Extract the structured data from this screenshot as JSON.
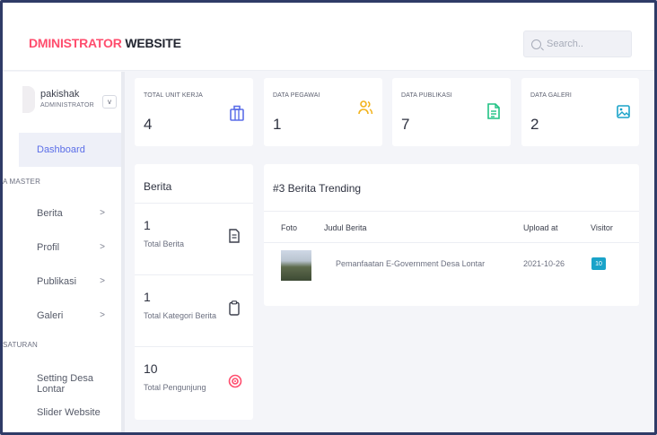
{
  "brand": {
    "accent": "DMINISTRATOR",
    "rest": " WEBSITE"
  },
  "search": {
    "placeholder": "Search.."
  },
  "profile": {
    "name": "pakishak",
    "role": "ADMINISTRATOR",
    "chevron": "v"
  },
  "sidebar": {
    "active": "Dashboard",
    "section_master": "A MASTER",
    "section_pengaturan": "SATURAN",
    "items": [
      {
        "label": "Berita",
        "chev": ">"
      },
      {
        "label": "Profil",
        "chev": ">"
      },
      {
        "label": "Publikasi",
        "chev": ">"
      },
      {
        "label": "Galeri",
        "chev": ">"
      }
    ],
    "settings": [
      {
        "label": "Setting Desa Lontar"
      },
      {
        "label": "Slider Website"
      }
    ]
  },
  "stats": [
    {
      "label": "TOTAL UNIT KERJA",
      "value": "4",
      "icon": "briefcase-icon",
      "color": "#5b6ee8"
    },
    {
      "label": "DATA PEGAWAI",
      "value": "1",
      "icon": "users-icon",
      "color": "#f2b21b"
    },
    {
      "label": "DATA PUBLIKASI",
      "value": "7",
      "icon": "document-icon",
      "color": "#20c284"
    },
    {
      "label": "DATA GALERI",
      "value": "2",
      "icon": "image-icon",
      "color": "#1aa3c9"
    }
  ],
  "berita": {
    "title": "Berita",
    "rows": [
      {
        "value": "1",
        "label": "Total Berita",
        "icon": "file-text-icon"
      },
      {
        "value": "1",
        "label": "Total Kategori Berita",
        "icon": "clipboard-icon"
      },
      {
        "value": "10",
        "label": "Total Pengunjung",
        "icon": "eye-icon",
        "color": "#ff4d6d"
      }
    ]
  },
  "trending": {
    "title": "#3 Berita Trending",
    "columns": [
      "Foto",
      "Judul Berita",
      "Upload at",
      "Visitor"
    ],
    "rows": [
      {
        "judul": "Pemanfaatan E-Government Desa Lontar",
        "upload": "2021-10-26",
        "visitor": "10"
      }
    ]
  }
}
